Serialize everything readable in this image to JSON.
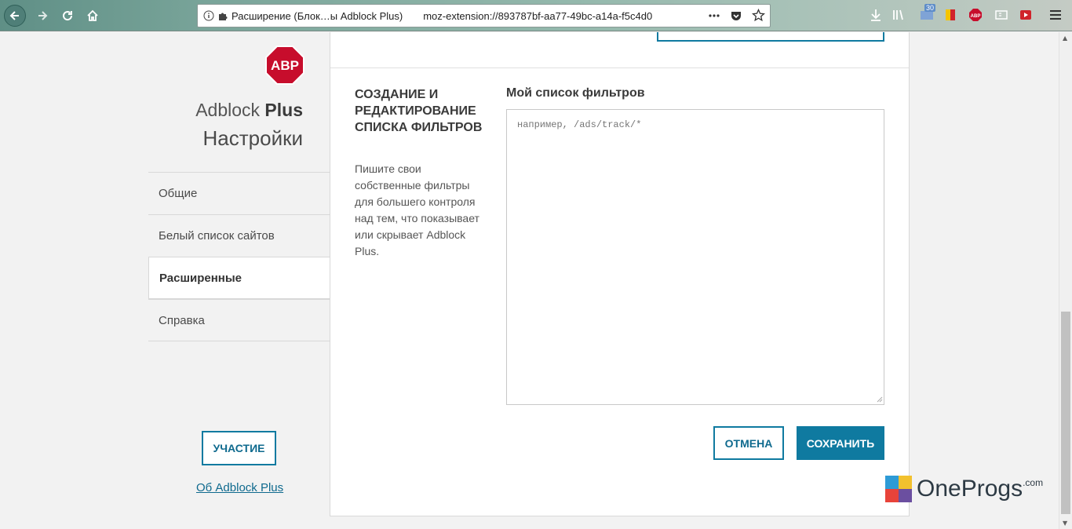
{
  "browser": {
    "tab_title": "Расширение (Блок…ы Adblock Plus)",
    "url": "moz-extension://893787bf-aa77-49bc-a14a-f5c4d0",
    "badge_count": "30",
    "icons": [
      "back-icon",
      "forward-icon",
      "reload-icon",
      "home-icon",
      "info-icon",
      "extension-icon",
      "more-icon",
      "pocket-icon",
      "star-icon",
      "download-icon",
      "library-icon",
      "abp-icon",
      "menu-icon"
    ]
  },
  "sidebar": {
    "logo_text": "ABP",
    "brand_prefix": "Adblock",
    "brand_suffix": "Plus",
    "title": "Настройки",
    "items": [
      {
        "label": "Общие"
      },
      {
        "label": "Белый список сайтов"
      },
      {
        "label": "Расширенные",
        "active": true
      },
      {
        "label": "Справка"
      }
    ],
    "contribute_label": "УЧАСТИЕ",
    "about_link": "Об Adblock Plus"
  },
  "main": {
    "section_heading": "СОЗДАНИЕ И РЕДАКТИРОВАНИЕ СПИСКА ФИЛЬТРОВ",
    "section_description": "Пишите свои собственные фильтры для большего контроля над тем, что показывает или скрывает Adblock Plus.",
    "list_label": "Мой список фильтров",
    "filter_placeholder": "например, /ads/track/*",
    "filter_value": "",
    "cancel_label": "ОТМЕНА",
    "save_label": "СОХРАНИТЬ"
  },
  "watermark": {
    "text": "OneProgs",
    "suffix": ".com"
  },
  "colors": {
    "accent": "#0f7aa0",
    "abp_red": "#c70d2c",
    "sidebar_bg": "#f2f2f2"
  }
}
